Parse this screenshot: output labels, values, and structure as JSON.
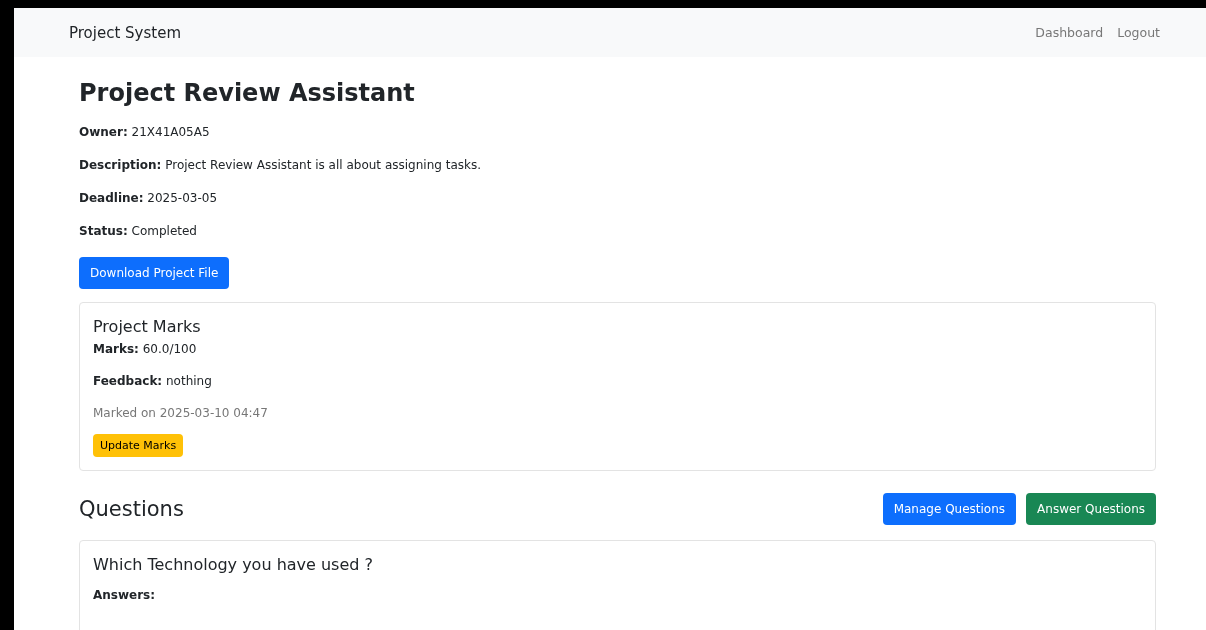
{
  "navbar": {
    "brand": "Project System",
    "links": [
      "Dashboard",
      "Logout"
    ]
  },
  "project": {
    "title": "Project Review Assistant",
    "fields": [
      {
        "label": "Owner:",
        "value": "21X41A05A5"
      },
      {
        "label": "Description:",
        "value": "Project Review Assistant is all about assigning tasks."
      },
      {
        "label": "Deadline:",
        "value": "2025-03-05"
      },
      {
        "label": "Status:",
        "value": "Completed"
      }
    ],
    "download_button": "Download Project File"
  },
  "marks_card": {
    "title": "Project Marks",
    "fields": [
      {
        "label": "Marks:",
        "value": "60.0/100"
      },
      {
        "label": "Feedback:",
        "value": "nothing"
      }
    ],
    "marked_on": "Marked on 2025-03-10 04:47",
    "update_button": "Update Marks"
  },
  "questions": {
    "heading": "Questions",
    "buttons": [
      {
        "label": "Manage Questions",
        "kind": "primary"
      },
      {
        "label": "Answer Questions",
        "kind": "success"
      }
    ],
    "items": [
      {
        "question": "Which Technology you have used ?",
        "answers_label": "Answers:"
      }
    ]
  }
}
